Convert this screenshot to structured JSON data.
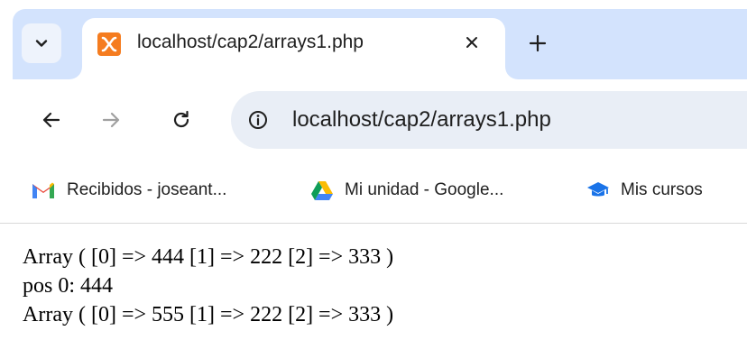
{
  "tab": {
    "title": "localhost/cap2/arrays1.php",
    "favicon": "xampp-icon",
    "favicon_color": "#f57c1f"
  },
  "toolbar": {
    "url": "localhost/cap2/arrays1.php"
  },
  "bookmarks": [
    {
      "icon": "gmail-icon",
      "label": "Recibidos - joseant..."
    },
    {
      "icon": "google-drive-icon",
      "label": "Mi unidad - Google..."
    },
    {
      "icon": "graduation-cap-icon",
      "label": "Mis cursos"
    }
  ],
  "page": {
    "lines": [
      "Array ( [0] => 444 [1] => 222 [2] => 333 )",
      "pos 0: 444",
      "Array ( [0] => 555 [1] => 222 [2] => 333 )"
    ]
  },
  "colors": {
    "tabstrip": "#d3e3fd",
    "omnibox": "#e9eef6"
  }
}
